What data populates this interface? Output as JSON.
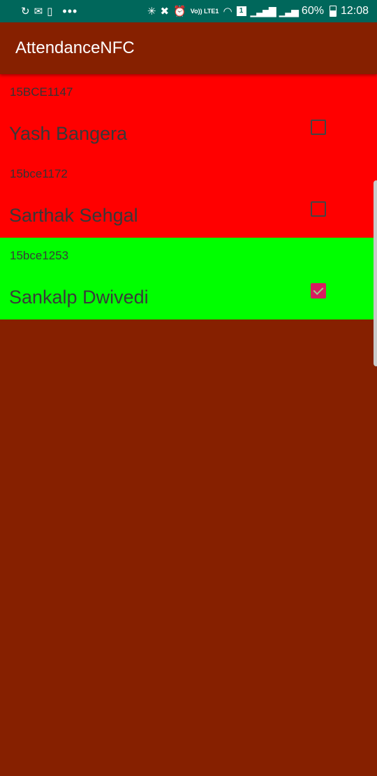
{
  "status_bar": {
    "left_icons": [
      "sync-icon",
      "mail-icon",
      "sim-icon"
    ],
    "overflow": "•••",
    "volte": "Vo)) LTE1",
    "sim_slot": "1",
    "battery": "60%",
    "battery_level": 0.6,
    "time": "12:08"
  },
  "app_bar": {
    "title": "AttendanceNFC"
  },
  "colors": {
    "background": "#862000",
    "absent": "#ff0000",
    "present": "#00ff00",
    "status_bar": "#00675b",
    "checkbox_accent": "#d81b60"
  },
  "students": [
    {
      "reg": "15BCE1147",
      "name": "Yash Bangera",
      "present": false
    },
    {
      "reg": "15bce1172",
      "name": "Sarthak Sehgal",
      "present": false
    },
    {
      "reg": "15bce1253",
      "name": "Sankalp Dwivedi",
      "present": true
    }
  ]
}
